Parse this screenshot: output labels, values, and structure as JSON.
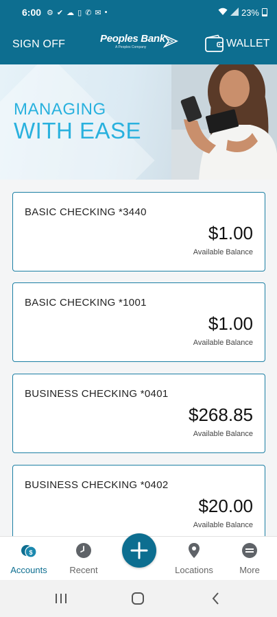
{
  "status_bar": {
    "time": "6:00",
    "battery": "23%"
  },
  "header": {
    "sign_off_label": "SIGN OFF",
    "logo_name": "Peoples Bank",
    "logo_tagline": "A Peoples Company",
    "wallet_label": "WALLET"
  },
  "hero": {
    "title_line1": "MANAGING",
    "title_line2": "WITH EASE"
  },
  "accounts": [
    {
      "name": "BASIC CHECKING *3440",
      "balance": "$1.00",
      "balance_label": "Available Balance"
    },
    {
      "name": "BASIC CHECKING *1001",
      "balance": "$1.00",
      "balance_label": "Available Balance"
    },
    {
      "name": "BUSINESS CHECKING *0401",
      "balance": "$268.85",
      "balance_label": "Available Balance"
    },
    {
      "name": "BUSINESS CHECKING *0402",
      "balance": "$20.00",
      "balance_label": "Available Balance"
    }
  ],
  "bottom_nav": {
    "items": [
      {
        "label": "Accounts",
        "icon": "accounts-coins-icon",
        "active": true
      },
      {
        "label": "Recent",
        "icon": "clock-icon",
        "active": false
      },
      {
        "label": "Locations",
        "icon": "location-pin-icon",
        "active": false
      },
      {
        "label": "More",
        "icon": "more-menu-icon",
        "active": false
      }
    ],
    "fab_icon": "plus-icon"
  },
  "colors": {
    "brand": "#0d6e90",
    "accent": "#29b1de",
    "card_border": "#1a7ea3"
  }
}
